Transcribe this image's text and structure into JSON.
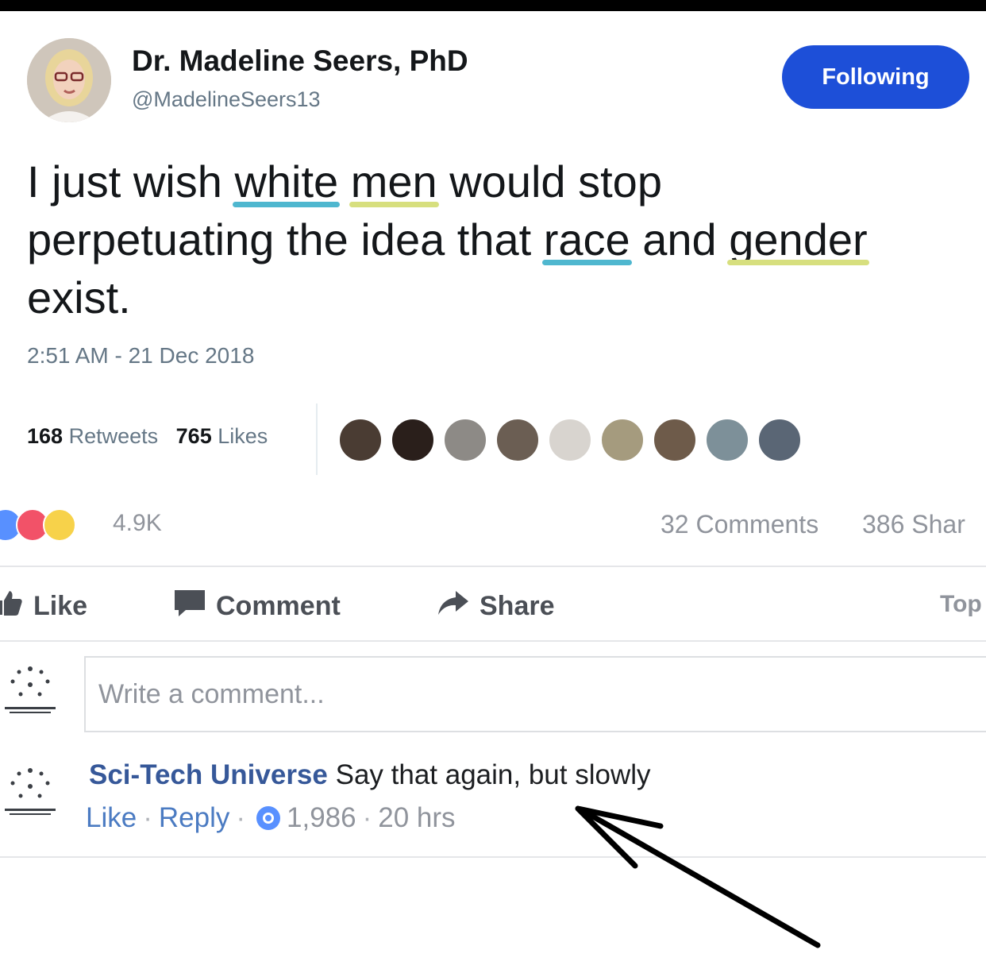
{
  "tweet": {
    "author_name": "Dr. Madeline Seers, PhD",
    "author_handle": "@MadelineSeers13",
    "follow_label": "Following",
    "text_words": [
      "I",
      "just",
      "wish",
      "white",
      "men",
      "would",
      "stop",
      "perpetuating",
      "the",
      "idea",
      "that",
      "race",
      "and",
      "gender",
      "exist."
    ],
    "timestamp": "2:51 AM - 21 Dec 2018",
    "retweets_count": "168",
    "retweets_label": "Retweets",
    "likes_count": "765",
    "likes_label": "Likes",
    "liker_avatars": [
      "avatar-1",
      "avatar-2",
      "avatar-3",
      "avatar-4",
      "avatar-5",
      "avatar-6",
      "avatar-7",
      "avatar-8",
      "avatar-9"
    ],
    "colors": {
      "follow_button": "#1d4fd8",
      "underline_blue": "#4fb7cf",
      "underline_yellow": "#d7df7e"
    }
  },
  "facebook": {
    "reactions_count": "4.9K",
    "reaction_icons": [
      "like-icon",
      "love-icon",
      "wow-icon"
    ],
    "comments_count": "32 Comments",
    "shares_count": "386 Shar",
    "actions": {
      "like": "Like",
      "comment": "Comment",
      "share": "Share"
    },
    "top_label": "Top",
    "comment_placeholder": "Write a comment...",
    "comment": {
      "author": "Sci-Tech Universe",
      "text": "Say that again, but slowly",
      "like_link": "Like",
      "reply_link": "Reply",
      "like_count": "1,986",
      "age": "20 hrs"
    }
  }
}
